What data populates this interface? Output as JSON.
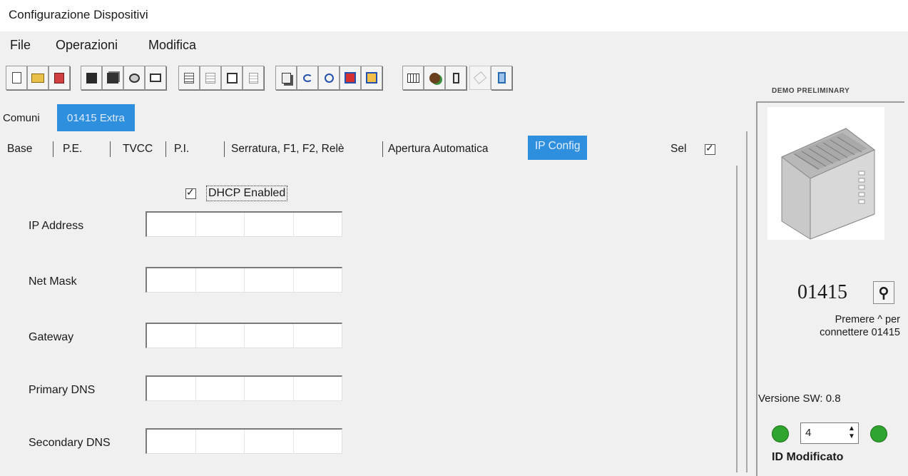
{
  "window": {
    "title": "Configurazione Dispositivi"
  },
  "menu": [
    "File",
    "Operazioni",
    "Modifica"
  ],
  "toolbar": {
    "buttons": [
      {
        "icon": "new-file-icon"
      },
      {
        "icon": "open-folder-icon"
      },
      {
        "icon": "export-icon"
      },
      {
        "icon": "save-icon"
      },
      {
        "icon": "save-all-icon"
      },
      {
        "icon": "print-preview-icon"
      },
      {
        "icon": "print-icon"
      },
      {
        "icon": "list-sort-icon"
      },
      {
        "icon": "list-icon"
      },
      {
        "icon": "edit-icon"
      },
      {
        "icon": "document-icon"
      },
      {
        "icon": "copy-icon"
      },
      {
        "icon": "undo-icon"
      },
      {
        "icon": "refresh-icon"
      },
      {
        "icon": "check-icon"
      },
      {
        "icon": "alert-icon"
      },
      {
        "icon": "calendar-icon"
      },
      {
        "icon": "network-icon"
      },
      {
        "icon": "phone-icon"
      },
      {
        "icon": "disabled-icon"
      },
      {
        "icon": "exit-icon"
      }
    ]
  },
  "tabs_top": [
    "Comuni",
    "01415 Extra"
  ],
  "tabs_second": [
    "Base",
    "P.E.",
    "TVCC",
    "P.I.",
    "Serratura, F1, F2, Relè",
    "Apertura Automatica",
    "IP Config"
  ],
  "sel_label": "Sel",
  "dhcp": {
    "label": "DHCP Enabled",
    "checked": true
  },
  "fields": [
    {
      "label": "IP Address"
    },
    {
      "label": "Net Mask"
    },
    {
      "label": "Gateway"
    },
    {
      "label": "Primary DNS"
    },
    {
      "label": "Secondary DNS"
    }
  ],
  "side": {
    "demo": "DEMO PRELIMINARY",
    "device_number": "01415",
    "hint_line1": "Premere ^ per",
    "hint_line2": "connettere 01415",
    "version": "Versione SW: 0.8",
    "id_value": "4",
    "id_label": "ID",
    "status": "Modificato"
  },
  "colors": {
    "tab_active": "#2f8fdf",
    "nav_green": "#2fa52f"
  }
}
